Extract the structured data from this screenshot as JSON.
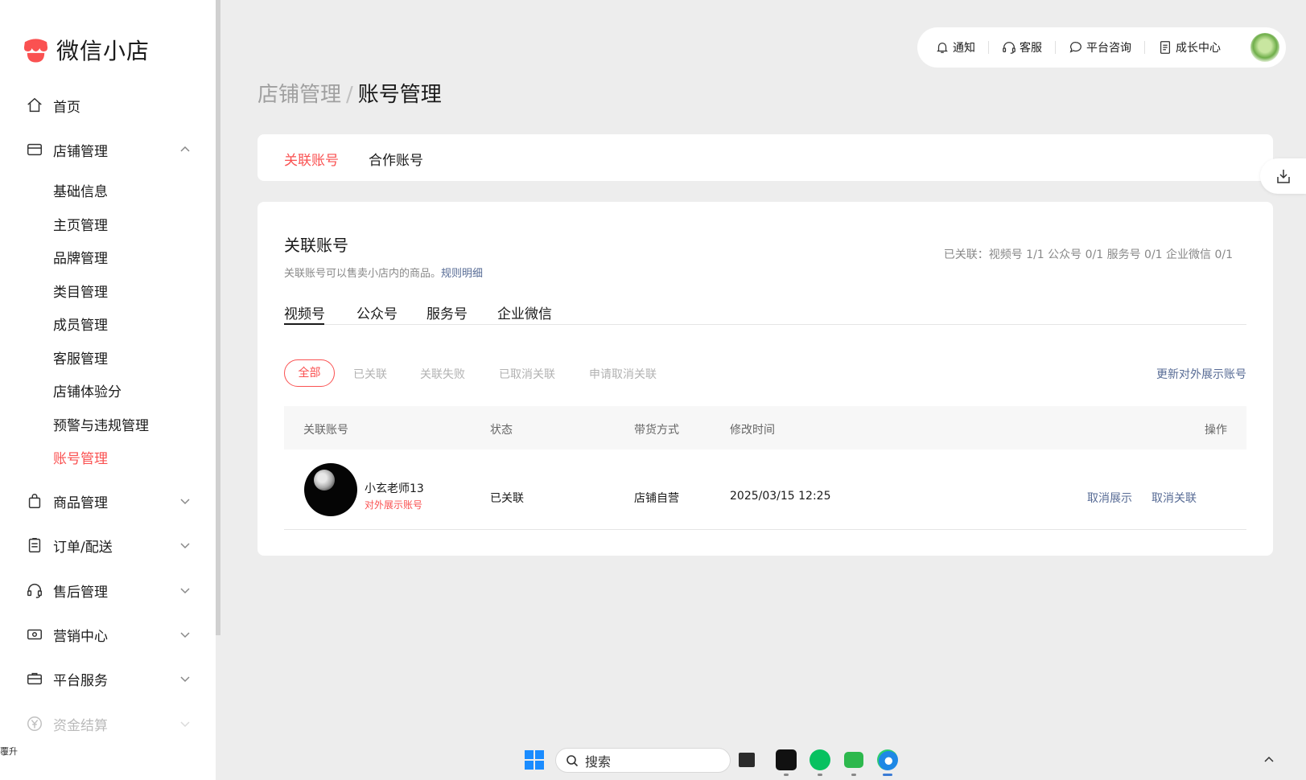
{
  "app": {
    "name": "微信小店",
    "brand_color": "#fa5151",
    "link_color": "#576b95"
  },
  "sidebar": {
    "items": [
      {
        "label": "首页",
        "icon": "home-icon"
      },
      {
        "label": "店铺管理",
        "icon": "store-icon",
        "expanded": true,
        "children": [
          "基础信息",
          "主页管理",
          "品牌管理",
          "类目管理",
          "成员管理",
          "客服管理",
          "店铺体验分",
          "预警与违规管理",
          "账号管理"
        ],
        "active_child": "账号管理"
      },
      {
        "label": "商品管理",
        "icon": "bag-icon"
      },
      {
        "label": "订单/配送",
        "icon": "clipboard-icon"
      },
      {
        "label": "售后管理",
        "icon": "headset-icon"
      },
      {
        "label": "营销中心",
        "icon": "ticket-icon"
      },
      {
        "label": "平台服务",
        "icon": "briefcase-icon"
      },
      {
        "label": "资金结算",
        "icon": "yen-icon"
      }
    ],
    "corner_text": "覆升"
  },
  "topbar": {
    "items": [
      {
        "label": "通知",
        "icon": "bell-icon"
      },
      {
        "label": "客服",
        "icon": "headset-icon"
      },
      {
        "label": "平台咨询",
        "icon": "chat-bubble-icon"
      },
      {
        "label": "成长中心",
        "icon": "document-icon"
      }
    ]
  },
  "breadcrumb": {
    "parent": "店铺管理",
    "separator": "/",
    "current": "账号管理"
  },
  "tabs": {
    "items": [
      "关联账号",
      "合作账号"
    ],
    "active": "关联账号"
  },
  "panel": {
    "title": "关联账号",
    "description": "关联账号可以售卖小店内的商品。",
    "rules_link": "规则明细",
    "summary": "已关联：视频号 1/1 公众号 0/1 服务号 0/1 企业微信 0/1",
    "subtabs": [
      "视频号",
      "公众号",
      "服务号",
      "企业微信"
    ],
    "active_subtab": "视频号",
    "filters": [
      "全部",
      "已关联",
      "关联失败",
      "已取消关联",
      "申请取消关联"
    ],
    "active_filter": "全部",
    "update_link": "更新对外展示账号",
    "table": {
      "headers": [
        "关联账号",
        "状态",
        "带货方式",
        "修改时间",
        "操作"
      ],
      "rows": [
        {
          "name": "小玄老师13",
          "tag": "对外展示账号",
          "status": "已关联",
          "mode": "店铺自营",
          "time": "2025/03/15 12:25",
          "actions": [
            "取消展示",
            "取消关联"
          ]
        }
      ]
    }
  },
  "taskbar": {
    "search_placeholder": "搜索"
  }
}
